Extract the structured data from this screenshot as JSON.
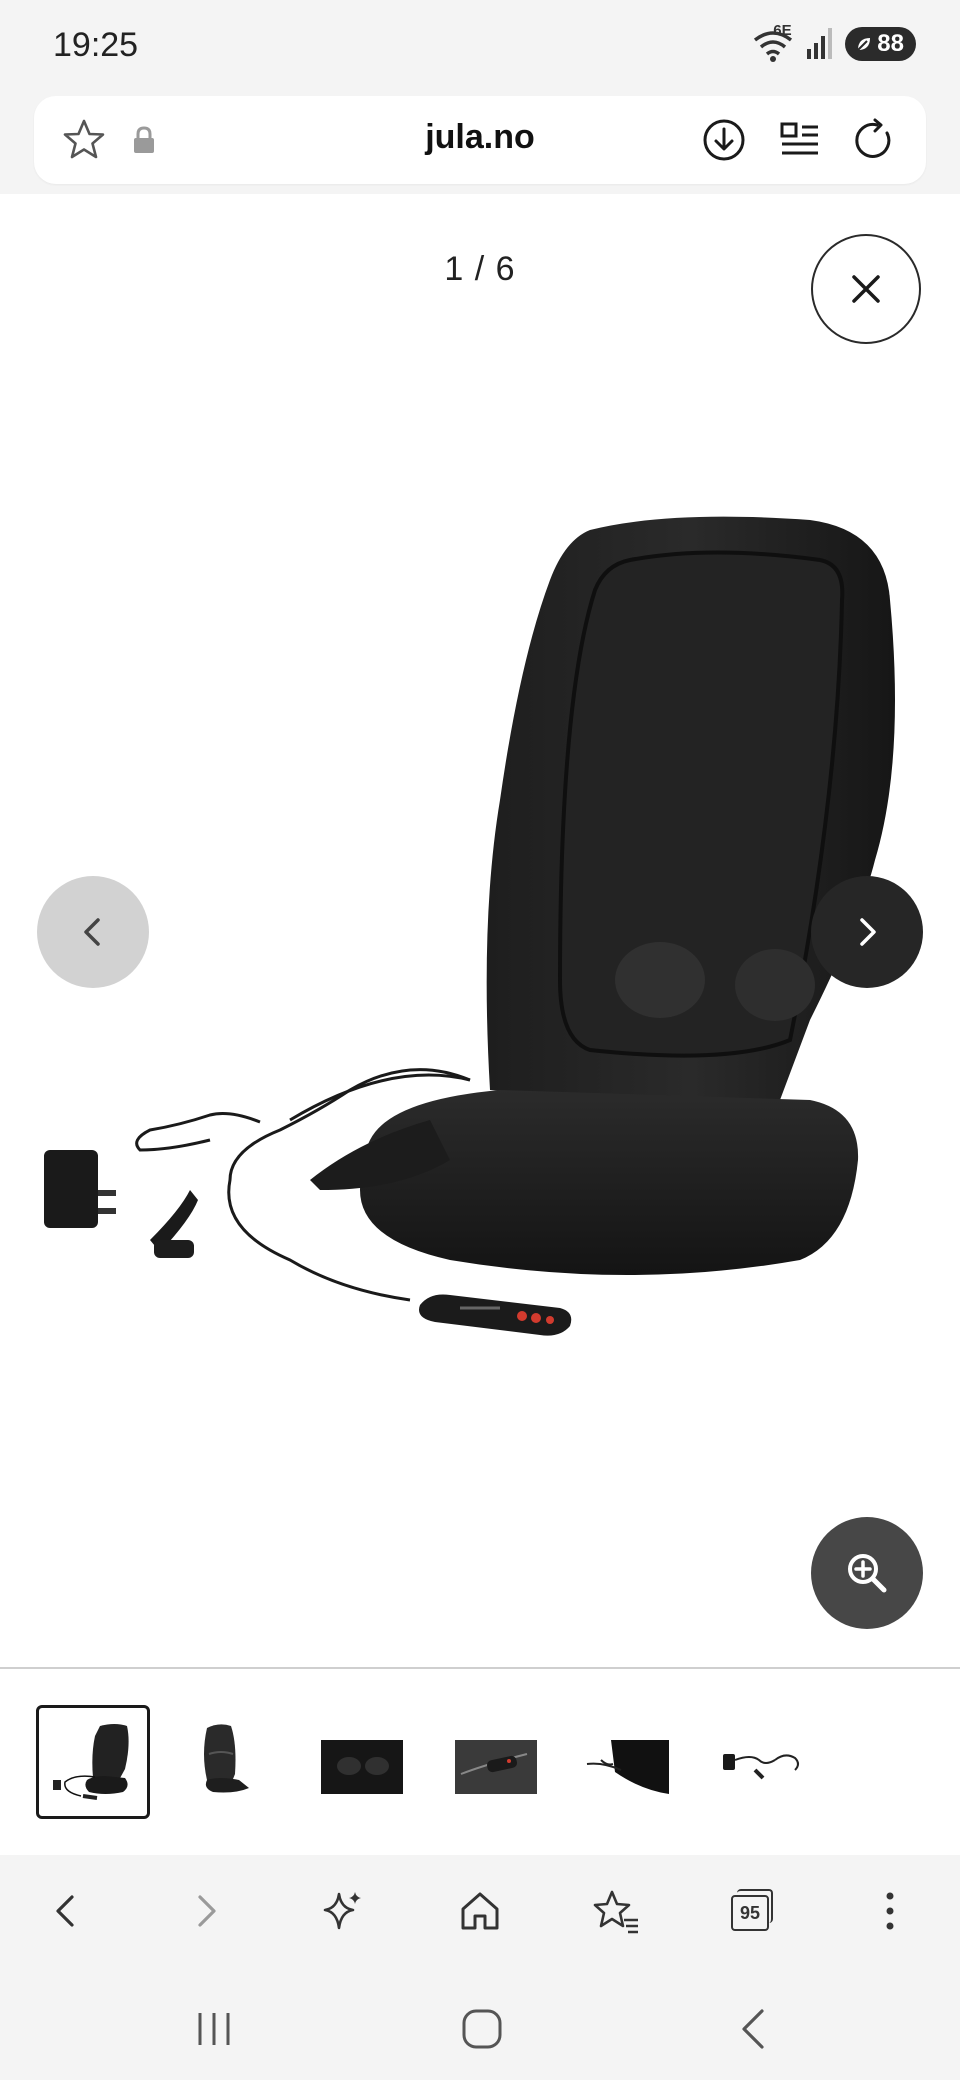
{
  "status_bar": {
    "time": "19:25",
    "network": "6E",
    "battery": "88",
    "icons": [
      "wifi-icon",
      "signal-icon",
      "battery-icon"
    ]
  },
  "browser": {
    "url": "jula.no",
    "icons": [
      "star-icon",
      "lock-icon",
      "download-icon",
      "reader-mode-icon",
      "reload-icon"
    ]
  },
  "gallery": {
    "counter": "1 / 6",
    "current_index": 1,
    "total": 6,
    "product_image": "black-massage-seat-cushion-with-remote-and-adapters",
    "thumbnails": [
      {
        "id": "thumb-1",
        "selected": true
      },
      {
        "id": "thumb-2",
        "selected": false
      },
      {
        "id": "thumb-3",
        "selected": false
      },
      {
        "id": "thumb-4",
        "selected": false
      },
      {
        "id": "thumb-5",
        "selected": false
      },
      {
        "id": "thumb-6",
        "selected": false
      }
    ]
  },
  "toolbar": {
    "tabs_count": "95",
    "items": [
      "back-icon",
      "forward-icon",
      "sparkle-icon",
      "home-icon",
      "bookmarks-icon",
      "tabs-icon",
      "more-icon"
    ]
  },
  "system_nav": {
    "items": [
      "recent-apps-icon",
      "home-icon",
      "back-icon"
    ]
  }
}
